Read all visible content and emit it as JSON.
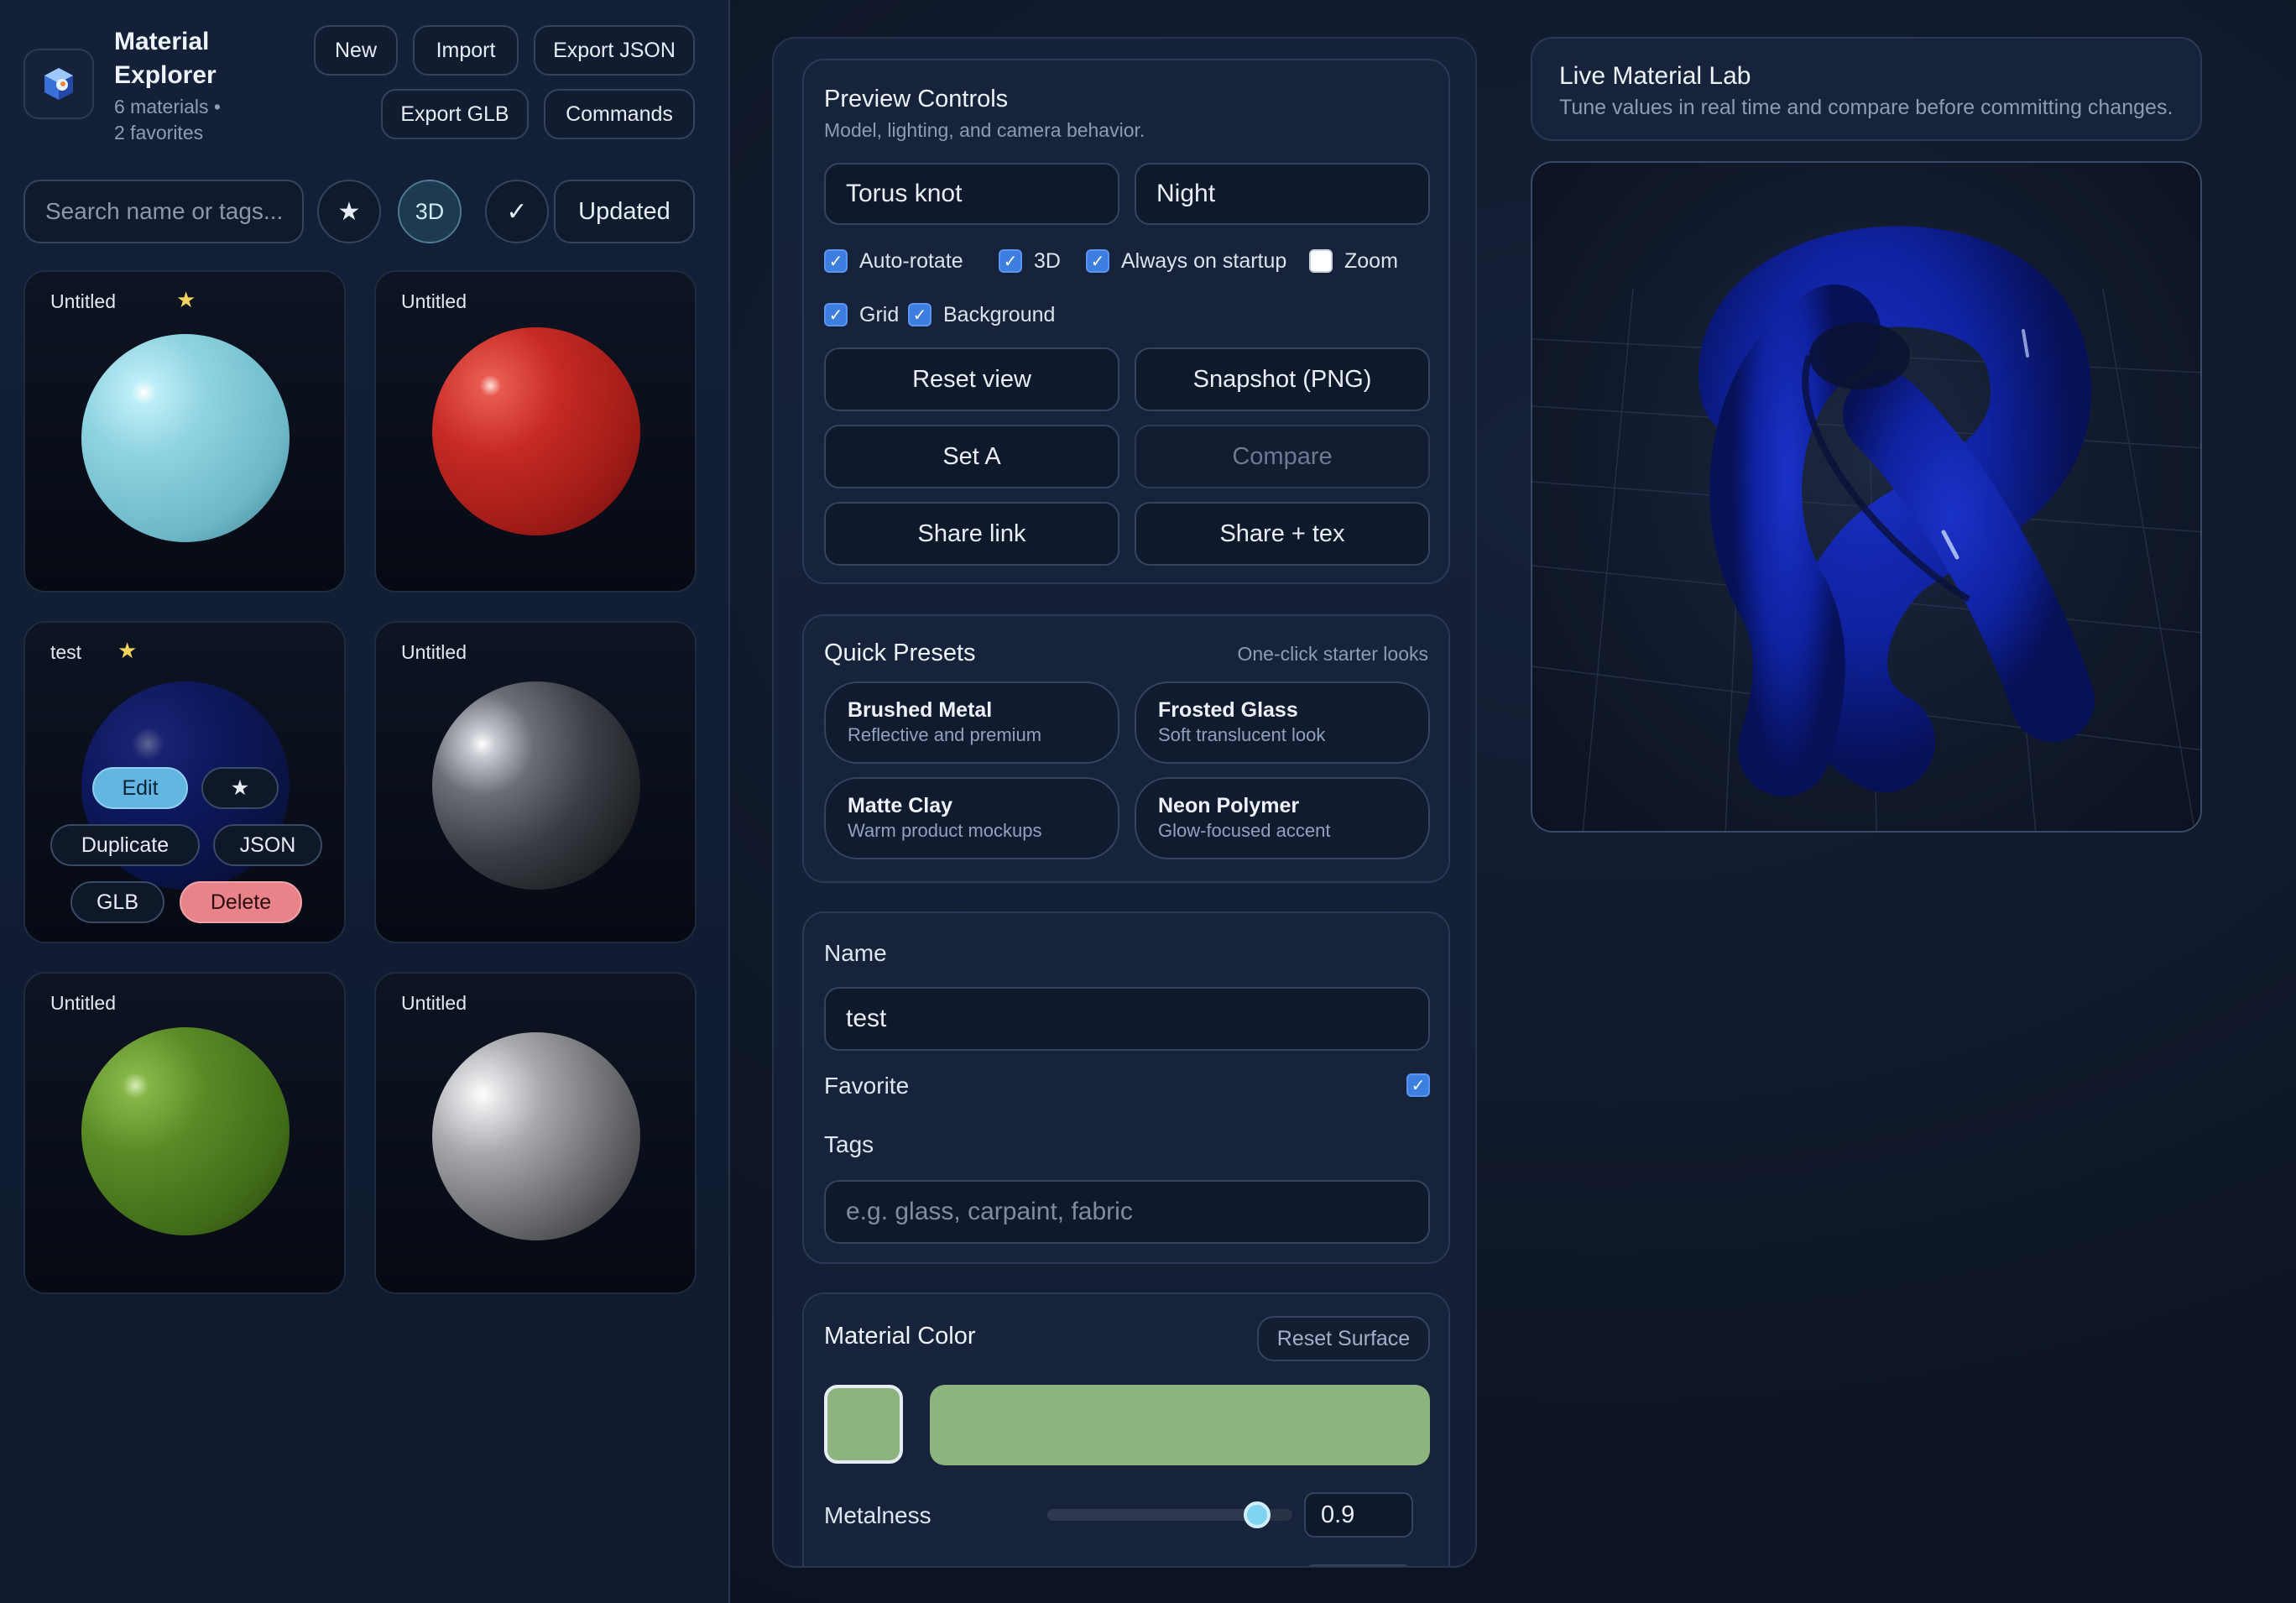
{
  "sidebar": {
    "title": "Material Explorer",
    "materials_count": "6 materials •",
    "favorites_count": "2 favorites",
    "buttons": {
      "new": "New",
      "import": "Import",
      "export_json": "Export JSON",
      "export_glb": "Export GLB",
      "commands": "Commands"
    },
    "search_placeholder": "Search name or tags...",
    "filters": {
      "favorites": "★",
      "three_d": "3D",
      "check": "✓",
      "sort": "Updated"
    },
    "cards": [
      {
        "name": "Untitled",
        "favorite": true,
        "color": "#8fd3e0"
      },
      {
        "name": "Untitled",
        "favorite": false,
        "color": "#c62a24"
      },
      {
        "name": "test",
        "favorite": true,
        "color": "#0e1a6a"
      },
      {
        "name": "Untitled",
        "favorite": false,
        "color": "#3a3d44"
      },
      {
        "name": "Untitled",
        "favorite": false,
        "color": "#5a8a26"
      },
      {
        "name": "Untitled",
        "favorite": false,
        "color": "#7a7c80"
      }
    ],
    "card_actions": {
      "edit": "Edit",
      "star": "★",
      "duplicate": "Duplicate",
      "json": "JSON",
      "glb": "GLB",
      "delete": "Delete"
    }
  },
  "preview_controls": {
    "title": "Preview Controls",
    "subtitle": "Model, lighting, and camera behavior.",
    "model": "Torus knot",
    "environment": "Night",
    "checkboxes": [
      {
        "label": "Auto-rotate",
        "checked": true
      },
      {
        "label": "3D",
        "checked": true
      },
      {
        "label": "Always on startup",
        "checked": true
      },
      {
        "label": "Zoom",
        "checked": false
      },
      {
        "label": "Grid",
        "checked": true
      },
      {
        "label": "Background",
        "checked": true
      }
    ],
    "buttons": {
      "reset_view": "Reset view",
      "snapshot": "Snapshot (PNG)",
      "set_a": "Set A",
      "compare": "Compare",
      "share_link": "Share link",
      "share_tex": "Share + tex"
    }
  },
  "quick_presets": {
    "title": "Quick Presets",
    "subtitle": "One-click starter looks",
    "items": [
      {
        "title": "Brushed Metal",
        "desc": "Reflective and premium"
      },
      {
        "title": "Frosted Glass",
        "desc": "Soft translucent look"
      },
      {
        "title": "Matte Clay",
        "desc": "Warm product mockups"
      },
      {
        "title": "Neon Polymer",
        "desc": "Glow-focused accent"
      }
    ]
  },
  "details": {
    "name_label": "Name",
    "name_value": "test",
    "favorite_label": "Favorite",
    "favorite_checked": true,
    "tags_label": "Tags",
    "tags_placeholder": "e.g. glass, carpaint, fabric"
  },
  "material": {
    "title": "Material Color",
    "reset_button": "Reset Surface",
    "color": "#8db37f",
    "metalness_label": "Metalness",
    "metalness_value": "0.9",
    "metalness": 0.9
  },
  "lab": {
    "title": "Live Material Lab",
    "subtitle": "Tune values in real time and compare before committing changes."
  },
  "colors": {
    "accent": "#63b6e2",
    "danger": "#e8838a",
    "star": "#f4d35e",
    "checkbox": "#3d7fe0"
  }
}
